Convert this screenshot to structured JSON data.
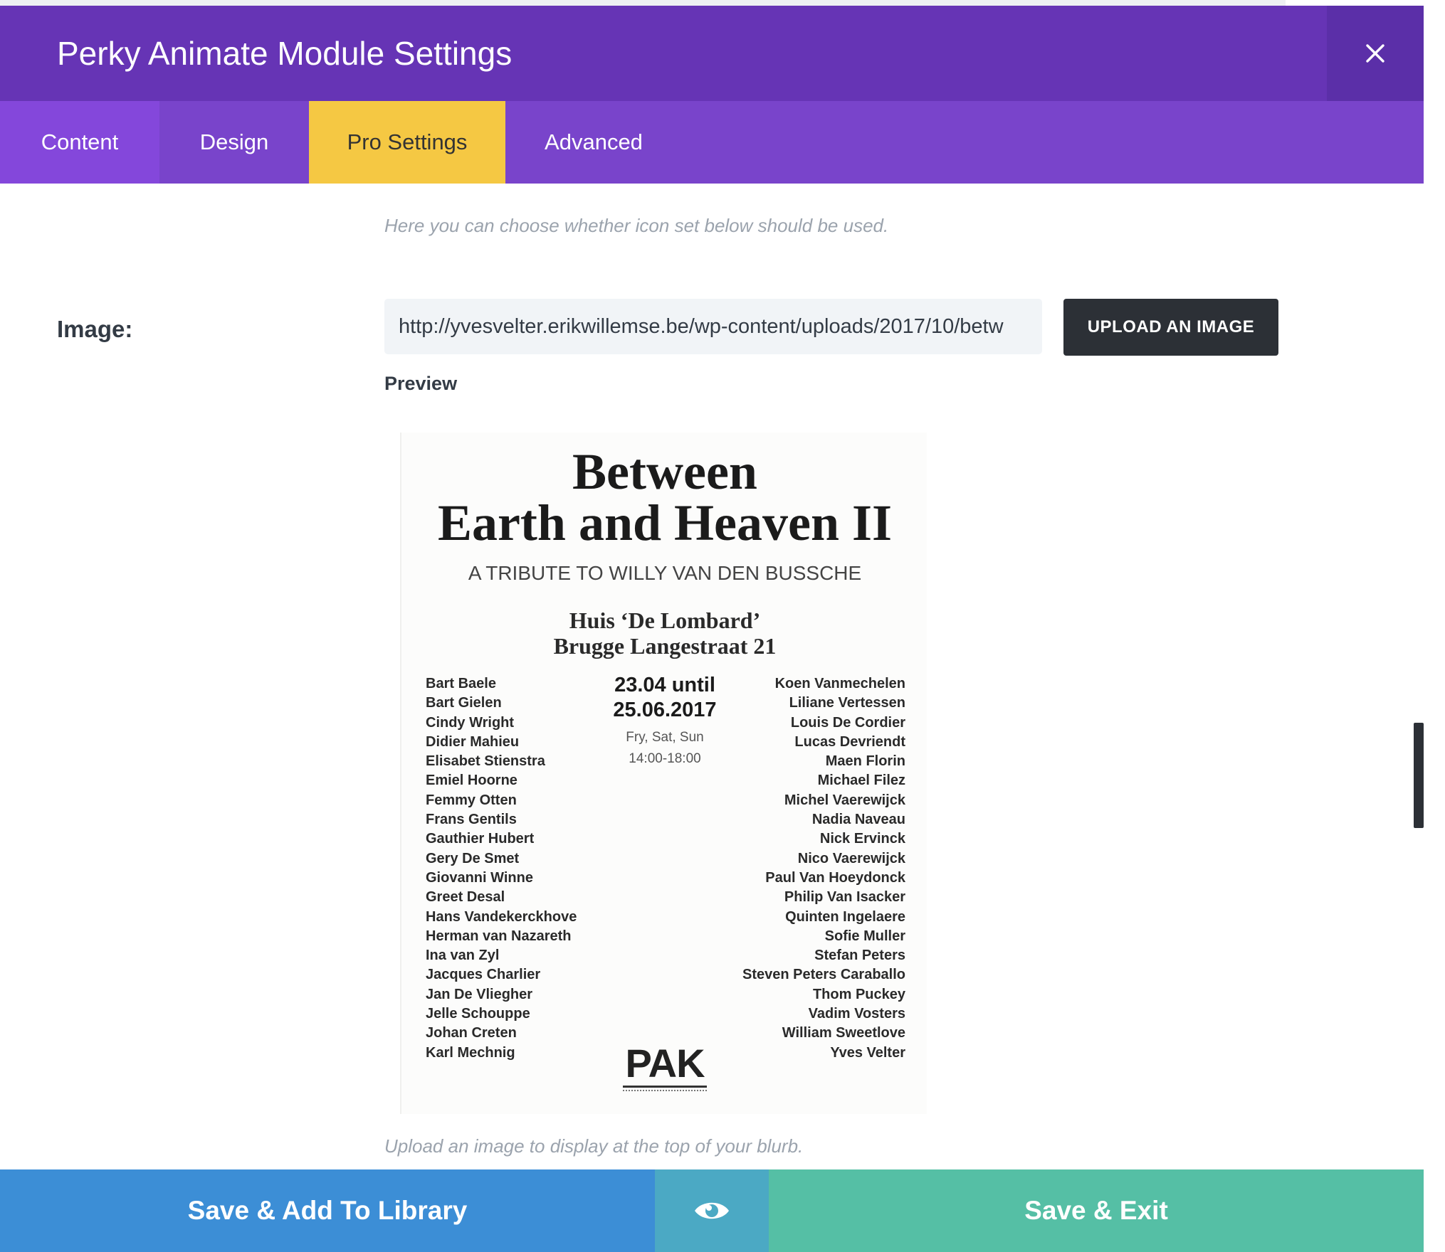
{
  "header": {
    "title": "Perky Animate Module Settings",
    "close_icon": "close-icon"
  },
  "tabs": [
    {
      "label": "Content",
      "active": false
    },
    {
      "label": "Design",
      "active": false
    },
    {
      "label": "Pro Settings",
      "active": true
    },
    {
      "label": "Advanced",
      "active": false
    }
  ],
  "content": {
    "icon_set_description": "Here you can choose whether icon set below should be used.",
    "image_label": "Image:",
    "image_url": "http://yvesvelter.erikwillemse.be/wp-content/uploads/2017/10/betw",
    "upload_button": "UPLOAD AN IMAGE",
    "preview_label": "Preview",
    "image_description": "Upload an image to display at the top of your blurb."
  },
  "poster": {
    "title_line1": "Between",
    "title_line2": "Earth and Heaven II",
    "subtitle": "A TRIBUTE TO WILLY VAN DEN BUSSCHE",
    "venue_line1": "Huis ‘De Lombard’",
    "venue_line2": "Brugge Langestraat 21",
    "date_line1": "23.04 until",
    "date_line2": "25.06.2017",
    "days": "Fry, Sat, Sun",
    "hours": "14:00-18:00",
    "artists_left": [
      "Bart Baele",
      "Bart Gielen",
      "Cindy Wright",
      "Didier Mahieu",
      "Elisabet Stienstra",
      "Emiel Hoorne",
      "Femmy Otten",
      "Frans Gentils",
      "Gauthier Hubert",
      "Gery De Smet",
      "Giovanni Winne",
      "Greet Desal",
      "Hans Vandekerckhove",
      "Herman van Nazareth",
      "Ina van Zyl",
      "Jacques Charlier",
      "Jan De Vliegher",
      "Jelle Schouppe",
      "Johan Creten",
      "Karl Mechnig"
    ],
    "artists_right": [
      "Koen Vanmechelen",
      "Liliane Vertessen",
      "Louis De Cordier",
      "Lucas Devriendt",
      "Maen Florin",
      "Michael Filez",
      "Michel Vaerewijck",
      "Nadia Naveau",
      "Nick Ervinck",
      "Nico Vaerewijck",
      "Paul Van Hoeydonck",
      "Philip Van Isacker",
      "Quinten Ingelaere",
      "Sofie Muller",
      "Stefan Peters",
      "Steven Peters Caraballo",
      "Thom Puckey",
      "Vadim Vosters",
      "William Sweetlove",
      "Yves Velter"
    ],
    "logo": "PAK"
  },
  "footer": {
    "save_library": "Save & Add To Library",
    "preview_icon": "eye-icon",
    "save_exit": "Save & Exit"
  },
  "colors": {
    "header": "#6634b5",
    "tab_bar": "#7944cb",
    "active_tab": "#f5c843",
    "save_library": "#3c8ed6",
    "preview": "#4ba9c4",
    "save_exit": "#55bfa5"
  }
}
